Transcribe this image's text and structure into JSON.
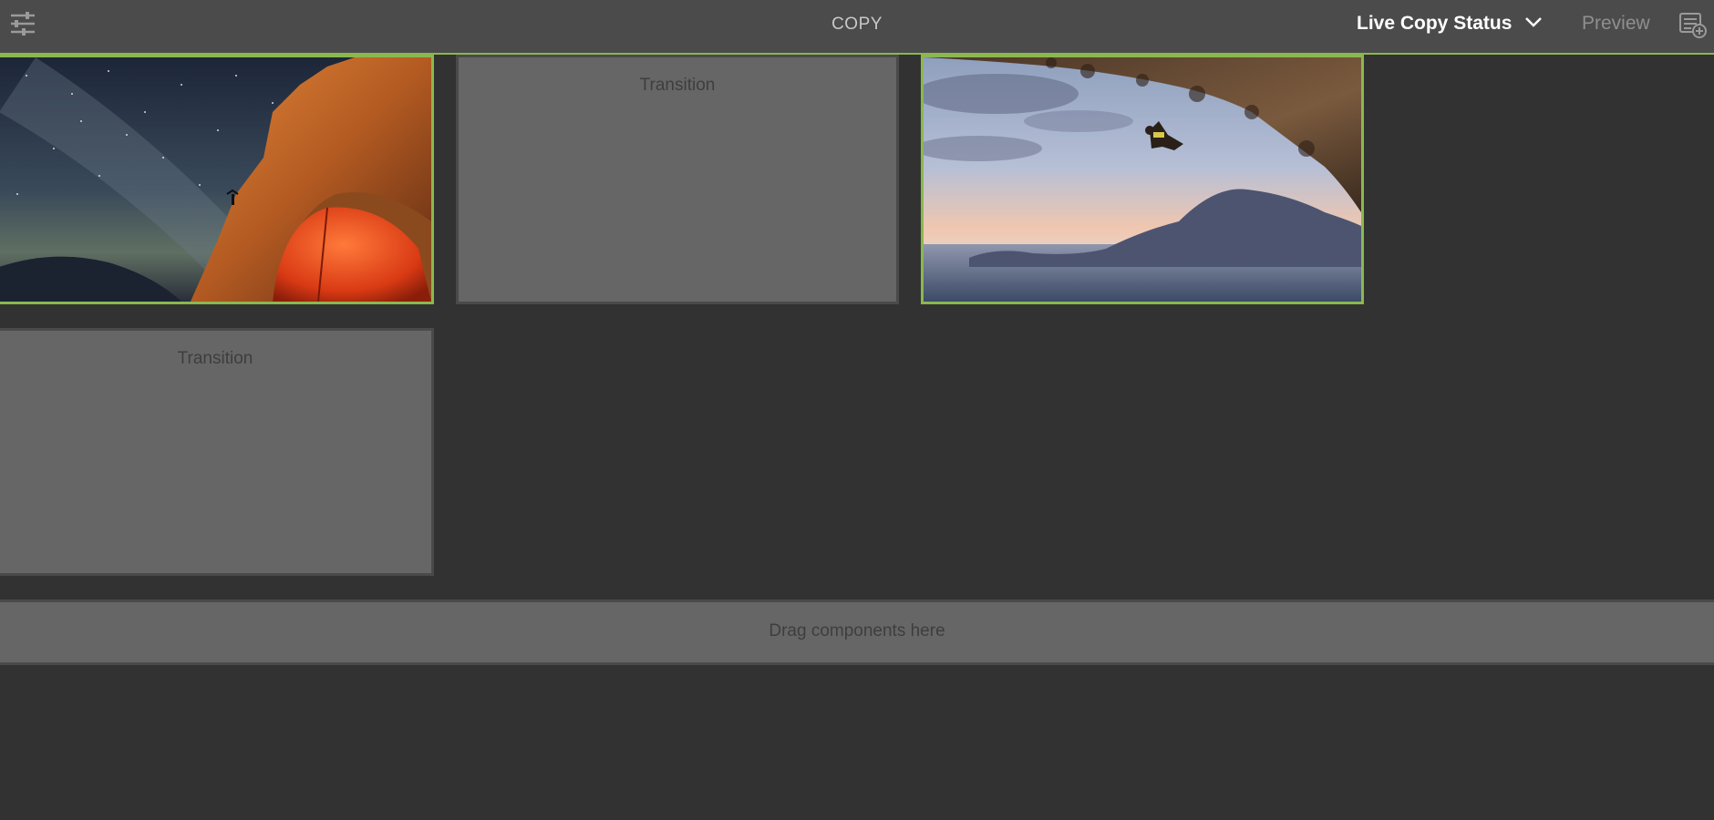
{
  "toolbar": {
    "title": "COPY",
    "live_copy_status_label": "Live Copy Status",
    "preview_label": "Preview",
    "settings_icon": "sliders-icon",
    "status_chevron_icon": "chevron-down-icon",
    "annotate_icon": "annotations-icon"
  },
  "grid": {
    "transition_1_label": "Transition",
    "transition_2_label": "Transition"
  },
  "dropzone": {
    "label": "Drag components here"
  },
  "colors": {
    "accent": "#8ab84e",
    "background": "#323232",
    "toolbar": "#4b4b4b",
    "placeholder": "#666666"
  }
}
